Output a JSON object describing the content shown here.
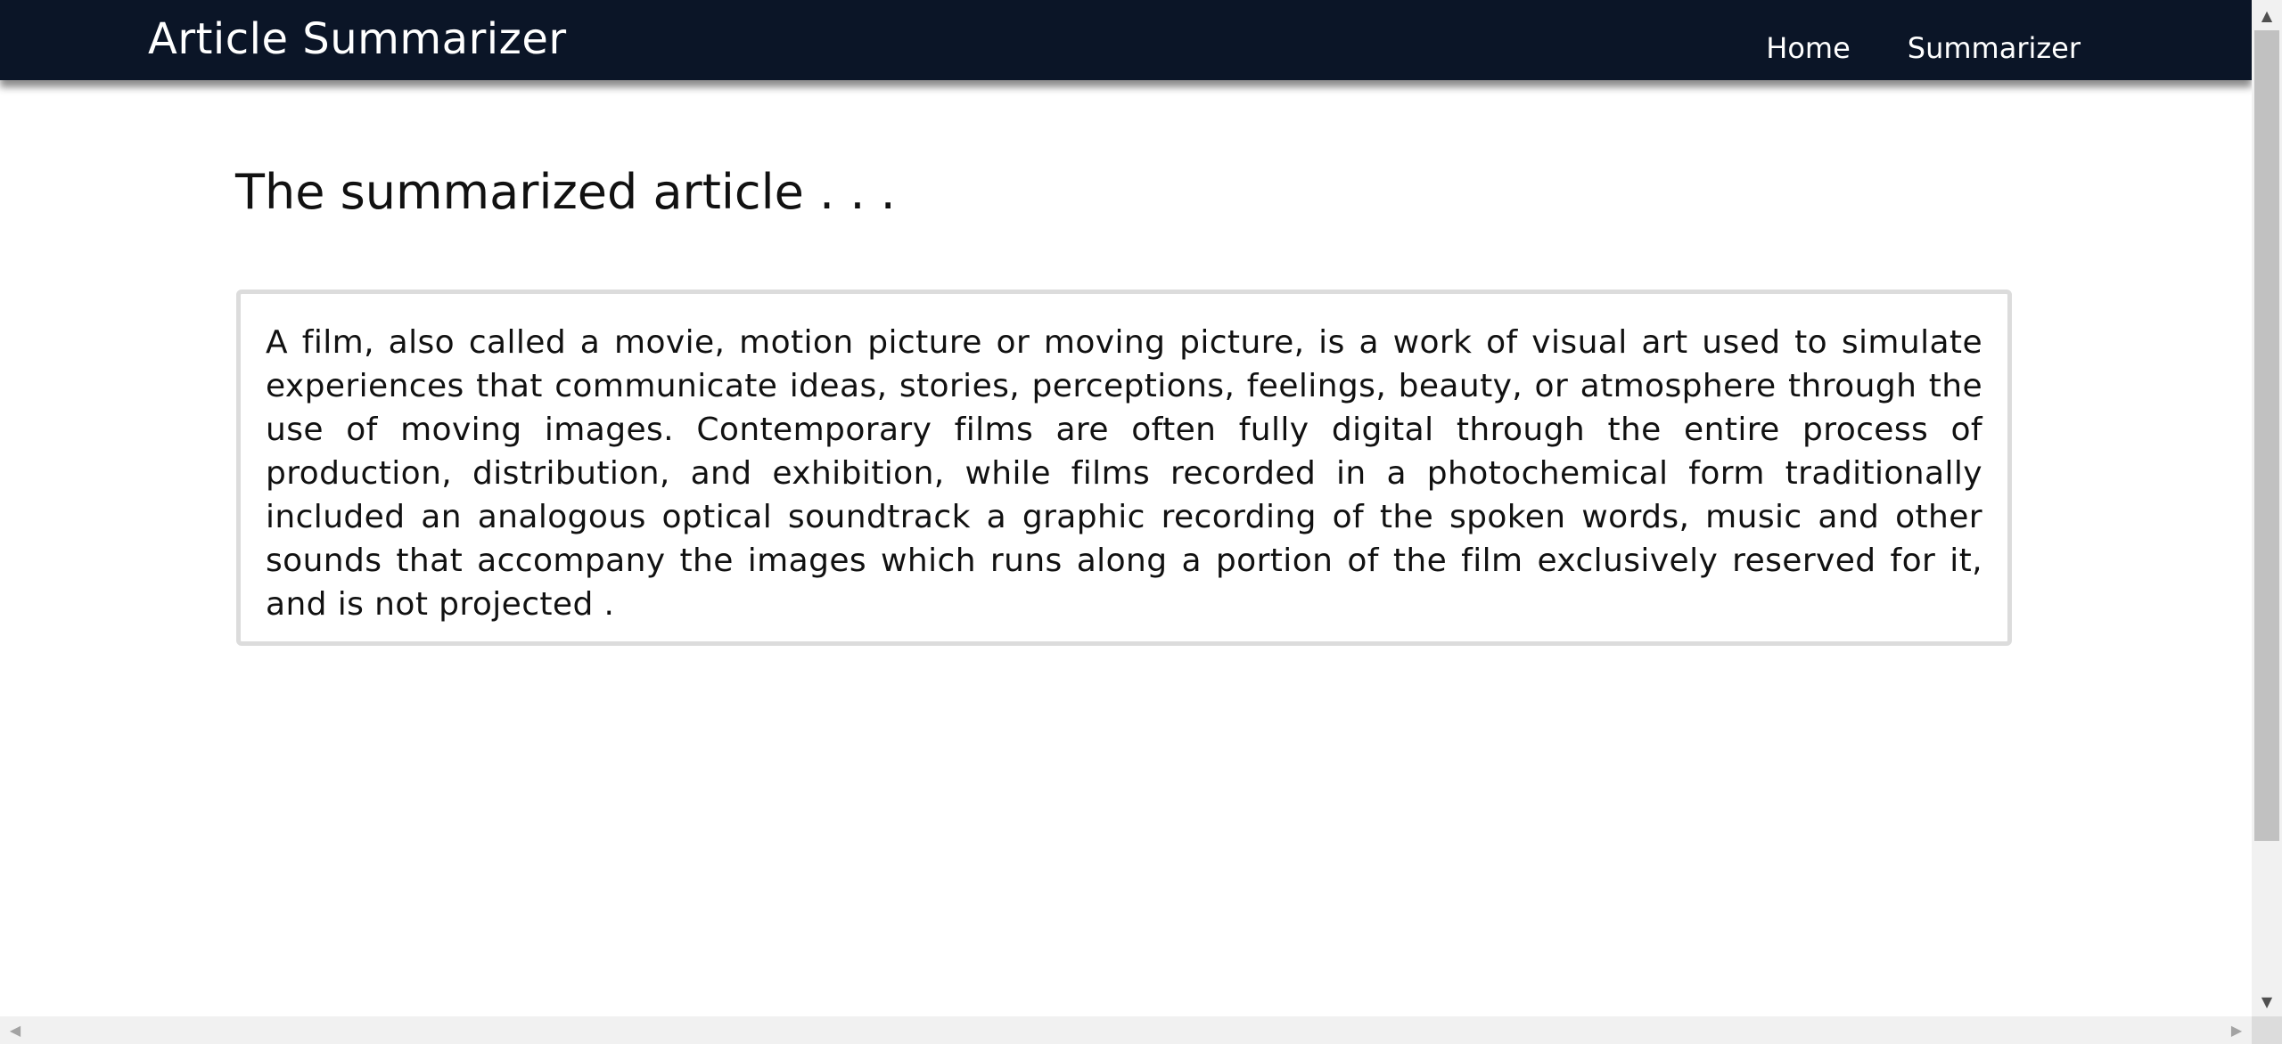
{
  "navbar": {
    "brand": "Article Summarizer",
    "links": [
      {
        "label": "Home"
      },
      {
        "label": "Summarizer"
      }
    ]
  },
  "main": {
    "title": "The summarized article . . .",
    "summary": "A film, also called a movie, motion picture or moving picture, is a work of visual art used to simulate experiences that communicate ideas, stories, perceptions, feelings, beauty, or atmosphere through the use of moving images. Contemporary films are often fully digital through the entire process of production, distribution, and exhibition, while films recorded in a photochemical form traditionally included an analogous optical soundtrack a graphic recording of the spoken words, music and other sounds that accompany the images which runs along a portion of the film exclusively reserved for it, and is not projected ."
  },
  "scrollbars": {
    "up_glyph": "▲",
    "down_glyph": "▼",
    "left_glyph": "◀",
    "right_glyph": "▶"
  },
  "colors": {
    "navbar_bg": "#0b1527",
    "navbar_text": "#ffffff",
    "box_border": "#dcdcdc"
  }
}
